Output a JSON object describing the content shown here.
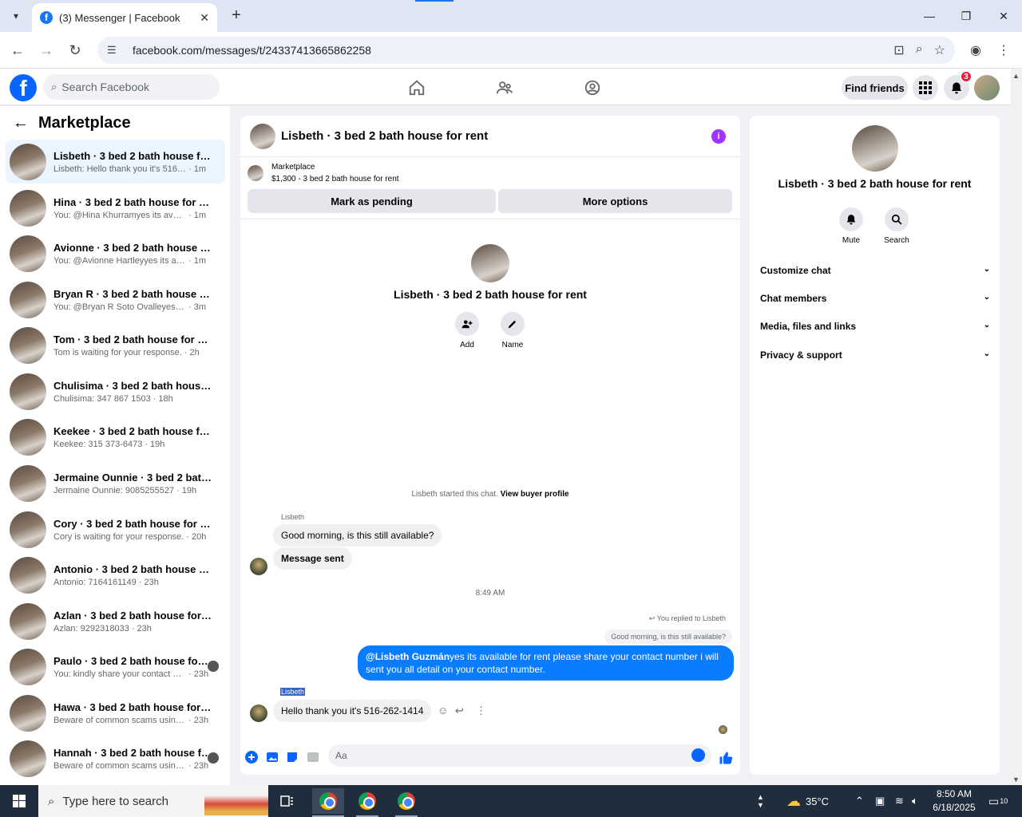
{
  "browser": {
    "tab_title": "(3) Messenger | Facebook",
    "url": "facebook.com/messages/t/24337413665862258"
  },
  "fb": {
    "search_placeholder": "Search Facebook",
    "find_friends": "Find friends",
    "notif_count": "3"
  },
  "sidebar": {
    "title": "Marketplace",
    "conversations": [
      {
        "name": "Lisbeth · 3 bed 2 bath house for rent",
        "snippet": "Lisbeth: Hello thank you it's 516-262-...",
        "time": "· 1m"
      },
      {
        "name": "Hina · 3 bed 2 bath house for rent",
        "snippet": "You: @Hina Khurramyes its available f...",
        "time": "· 1m"
      },
      {
        "name": "Avionne · 3 bed 2 bath house for r...",
        "snippet": "You: @Avionne Hartleyyes its availabl...",
        "time": "· 1m"
      },
      {
        "name": "Bryan R · 3 bed 2 bath house for r...",
        "snippet": "You: @Bryan R Soto Ovalleyes its avai...",
        "time": "· 3m"
      },
      {
        "name": "Tom · 3 bed 2 bath house for rent",
        "snippet": "Tom is waiting for your response.",
        "time": "· 2h"
      },
      {
        "name": "Chulisima · 3 bed 2 bath house for...",
        "snippet": "Chulisima: 347 867 1503",
        "time": "· 18h"
      },
      {
        "name": "Keekee · 3 bed 2 bath house for rent",
        "snippet": "Keekee: 315 373-6473",
        "time": "· 19h"
      },
      {
        "name": "Jermaine Ounnie · 3 bed 2 bath ho...",
        "snippet": "Jermaine Ounnie: 9085255527",
        "time": "· 19h"
      },
      {
        "name": "Cory · 3 bed 2 bath house for rent",
        "snippet": "Cory is waiting for your response.",
        "time": "· 20h"
      },
      {
        "name": "Antonio · 3 bed 2 bath house for r...",
        "snippet": "Antonio: 7164161149",
        "time": "· 23h"
      },
      {
        "name": "Azlan · 3 bed 2 bath house for rent",
        "snippet": "Azlan: 9292318033",
        "time": "· 23h"
      },
      {
        "name": "Paulo · 3 bed 2 bath house for r...",
        "snippet": "You: kindly share your contact nu...",
        "time": "· 23h"
      },
      {
        "name": "Hawa · 3 bed 2 bath house for rent",
        "snippet": "Beware of common scams using pay...",
        "time": "· 23h"
      },
      {
        "name": "Hannah · 3 bed 2 bath house for...",
        "snippet": "Beware of common scams using ...",
        "time": "· 23h"
      }
    ]
  },
  "chat": {
    "title": "Lisbeth · 3 bed 2 bath house for rent",
    "marketplace_label": "Marketplace",
    "listing": "$1,300 - 3 bed 2 bath house for rent",
    "mark_pending": "Mark as pending",
    "more_options": "More options",
    "intro_name": "Lisbeth · 3 bed 2 bath house for rent",
    "add_label": "Add",
    "name_label": "Name",
    "started_text": "Lisbeth started this chat. ",
    "view_profile": "View buyer profile",
    "sender1": "Lisbeth",
    "msg1": "Good morning, is this still available?",
    "msg2": "Message sent",
    "timestamp": "8:49 AM",
    "replied": "You replied to Lisbeth",
    "quoted": "Good morning, is this still available?",
    "out_mention": "@Lisbeth Guzmán",
    "out_text": "yes its available for rent please share your contact number i will sent you all detail on your contact number.",
    "sender2": "Lisbeth",
    "msg3": "Hello thank you it's 516-262-1414",
    "composer_placeholder": "Aa"
  },
  "details": {
    "name": "Lisbeth · 3 bed 2 bath house for rent",
    "mute": "Mute",
    "search": "Search",
    "sections": [
      "Customize chat",
      "Chat members",
      "Media, files and links",
      "Privacy & support"
    ]
  },
  "taskbar": {
    "search_placeholder": "Type here to search",
    "temperature": "35°C",
    "time": "8:50 AM",
    "date": "6/18/2025",
    "notif_count": "10"
  }
}
